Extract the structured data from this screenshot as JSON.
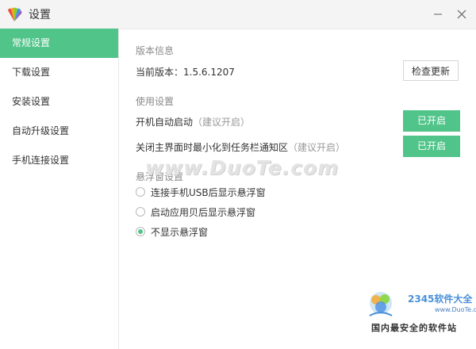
{
  "window": {
    "title": "设置",
    "icons": {
      "app": "app-fan-logo-icon",
      "minimize": "minimize-icon",
      "close": "close-icon"
    }
  },
  "sidebar": {
    "items": [
      {
        "label": "常规设置",
        "active": true
      },
      {
        "label": "下载设置"
      },
      {
        "label": "安装设置"
      },
      {
        "label": "自动升级设置"
      },
      {
        "label": "手机连接设置"
      }
    ]
  },
  "version": {
    "section_title": "版本信息",
    "current_label": "当前版本：1.5.6.1207",
    "check_button": "检查更新"
  },
  "usage": {
    "section_title": "使用设置",
    "autostart_label": "开机自动启动",
    "autostart_hint": "（建议开启）",
    "autostart_button": "已开启",
    "minimize_label": "关闭主界面时最小化到任务栏通知区",
    "minimize_hint": "（建议开启）",
    "minimize_button": "已开启"
  },
  "float_window": {
    "section_title": "悬浮窗设置",
    "options": [
      {
        "label": "连接手机USB后显示悬浮窗",
        "checked": false
      },
      {
        "label": "启动应用贝后显示悬浮窗",
        "checked": false
      },
      {
        "label": "不显示悬浮窗",
        "checked": true
      }
    ]
  },
  "watermarks": {
    "center": "www.DuoTe.com",
    "corner_brand": "2345软件大全",
    "corner_url": "www.DuoTe.com",
    "corner_slogan": "国内最安全的软件站"
  },
  "colors": {
    "accent": "#51c48a",
    "sidebar_active_text": "#ffffff",
    "section_title": "#8a8a8a",
    "hint": "#999999"
  }
}
